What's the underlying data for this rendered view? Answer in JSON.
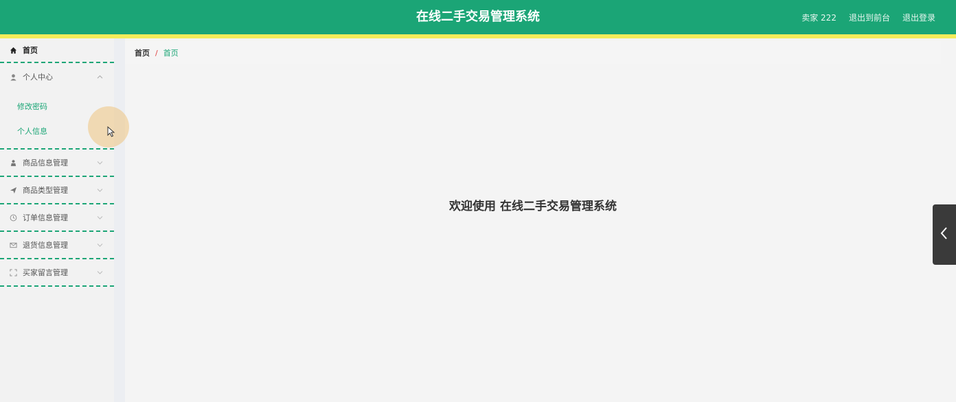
{
  "header": {
    "title": "在线二手交易管理系统",
    "user": "卖家 222",
    "front_link": "退出到前台",
    "logout_link": "退出登录"
  },
  "sidebar": {
    "home": "首页",
    "personal_center": {
      "label": "个人中心",
      "icon": "user-icon",
      "expanded": true,
      "children": [
        "修改密码",
        "个人信息"
      ]
    },
    "menus": [
      {
        "label": "商品信息管理",
        "icon": "person-icon"
      },
      {
        "label": "商品类型管理",
        "icon": "send-icon"
      },
      {
        "label": "订单信息管理",
        "icon": "clock-icon"
      },
      {
        "label": "退货信息管理",
        "icon": "mail-icon"
      },
      {
        "label": "买家留言管理",
        "icon": "expand-icon"
      }
    ]
  },
  "breadcrumb": {
    "home": "首页",
    "separator": "/",
    "current": "首页"
  },
  "main": {
    "welcome": "欢迎使用 在线二手交易管理系统"
  },
  "colors": {
    "primary": "#1ba576",
    "stripe": "#f4ec5a",
    "separator": "#e04040"
  }
}
